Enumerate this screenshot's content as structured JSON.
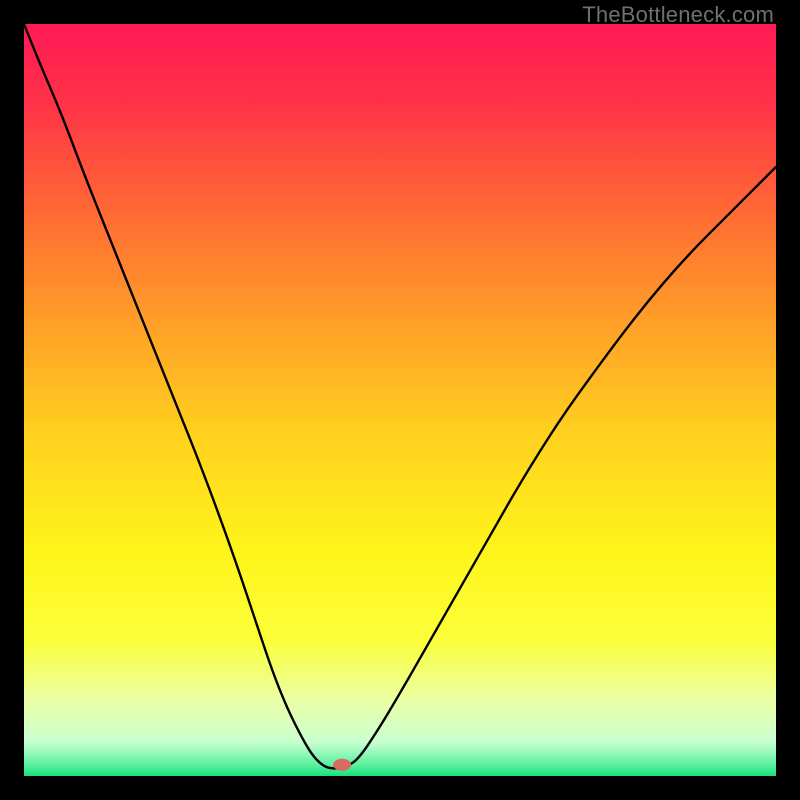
{
  "watermark": "TheBottleneck.com",
  "chart_data": {
    "type": "line",
    "title": "",
    "xlabel": "",
    "ylabel": "",
    "xlim": [
      0,
      100
    ],
    "ylim": [
      0,
      100
    ],
    "gradient_stops": [
      {
        "offset": 0.0,
        "color": "#ff1a55"
      },
      {
        "offset": 0.1,
        "color": "#ff3048"
      },
      {
        "offset": 0.25,
        "color": "#ff6a34"
      },
      {
        "offset": 0.4,
        "color": "#ffa028"
      },
      {
        "offset": 0.55,
        "color": "#ffd21e"
      },
      {
        "offset": 0.7,
        "color": "#fff41a"
      },
      {
        "offset": 0.82,
        "color": "#fbff3a"
      },
      {
        "offset": 0.9,
        "color": "#eaffa6"
      },
      {
        "offset": 0.955,
        "color": "#c8ffd0"
      },
      {
        "offset": 0.985,
        "color": "#5cf0a0"
      },
      {
        "offset": 1.0,
        "color": "#16e27a"
      }
    ],
    "series": [
      {
        "name": "curve",
        "x": [
          0,
          2,
          5,
          8,
          12,
          16,
          20,
          24,
          28,
          31,
          33,
          35,
          37,
          38.5,
          40,
          41,
          42,
          43,
          44.5,
          47,
          50,
          54,
          58,
          62,
          66,
          71,
          76,
          82,
          88,
          94,
          100
        ],
        "y": [
          100,
          95,
          88,
          80,
          70,
          60,
          50,
          40,
          29,
          20,
          14,
          9,
          5,
          2.5,
          1.2,
          1.0,
          1.0,
          1.3,
          2.3,
          6,
          11,
          18,
          25,
          32,
          39,
          47,
          54,
          62,
          69,
          75,
          81
        ]
      }
    ],
    "marker": {
      "x": 42.3,
      "y": 1.5,
      "color": "#d86a5e",
      "rx": 9,
      "ry": 6
    }
  }
}
